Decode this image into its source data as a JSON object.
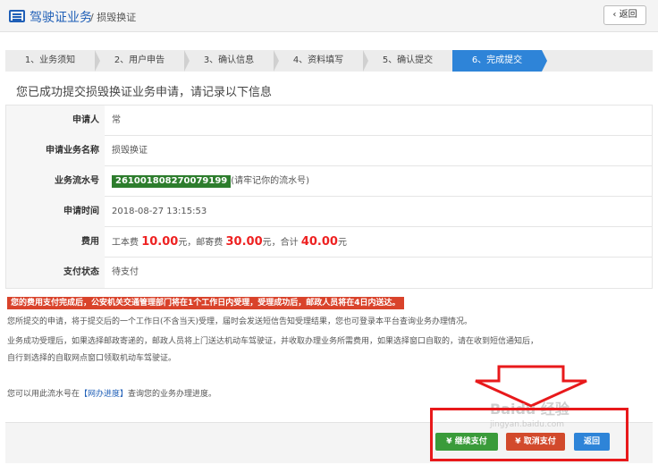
{
  "header": {
    "title": "驾驶证业务",
    "subtitle": "/ 损毁换证",
    "back_label": "‹ 返回"
  },
  "steps": [
    {
      "label": "1、业务须知"
    },
    {
      "label": "2、用户申告"
    },
    {
      "label": "3、确认信息"
    },
    {
      "label": "4、资料填写"
    },
    {
      "label": "5、确认提交"
    },
    {
      "label": "6、完成提交",
      "active": true
    }
  ],
  "notice": "您已成功提交损毁换证业务申请，请记录以下信息",
  "rows": {
    "applicant": {
      "label": "申请人",
      "value": "常"
    },
    "business": {
      "label": "申请业务名称",
      "value": "损毁换证"
    },
    "serial": {
      "label": "业务流水号",
      "value": "261001808270079199",
      "hint": "(请牢记你的流水号)"
    },
    "time": {
      "label": "申请时间",
      "value": "2018-08-27 13:15:53"
    },
    "fee": {
      "label": "费用",
      "p1": "工本费",
      "v1": "10.00",
      "p2": "元，邮寄费",
      "v2": "30.00",
      "p3": "元，合计",
      "v3": "40.00",
      "p4": "元"
    },
    "pay_status": {
      "label": "支付状态",
      "value": "待支付"
    }
  },
  "alert": "您的费用支付完成后，公安机关交通管理部门将在1个工作日内受理，受理成功后，邮政人员将在4日内送达。",
  "paragraphs": {
    "p1": "您所提交的申请，将于提交后的一个工作日(不含当天)受理，届时会发送短信告知受理结果，您也可登录本平台查询业务办理情况。",
    "p2": "业务成功受理后，如果选择邮政寄递的，邮政人员将上门送达机动车驾驶证，并收取办理业务所需费用，如果选择窗口自取的，请在收到短信通知后，",
    "p3": "自行到选择的自取网点窗口领取机动车驾驶证。",
    "p4_pre": "您可以用此流水号在",
    "p4_link": "【网办进度】",
    "p4_post": "查询您的业务办理进度。"
  },
  "buttons": {
    "continue_pay": "¥ 继续支付",
    "cancel_pay": "¥ 取消支付",
    "return": "返回"
  },
  "watermark": {
    "text": "Baidu 经验",
    "sub": "jingyan.baidu.com"
  },
  "colors": {
    "primary": "#2e84d8",
    "green": "#3a9b3a",
    "red": "#d24a2c",
    "highlight_box": "#e8191b"
  }
}
